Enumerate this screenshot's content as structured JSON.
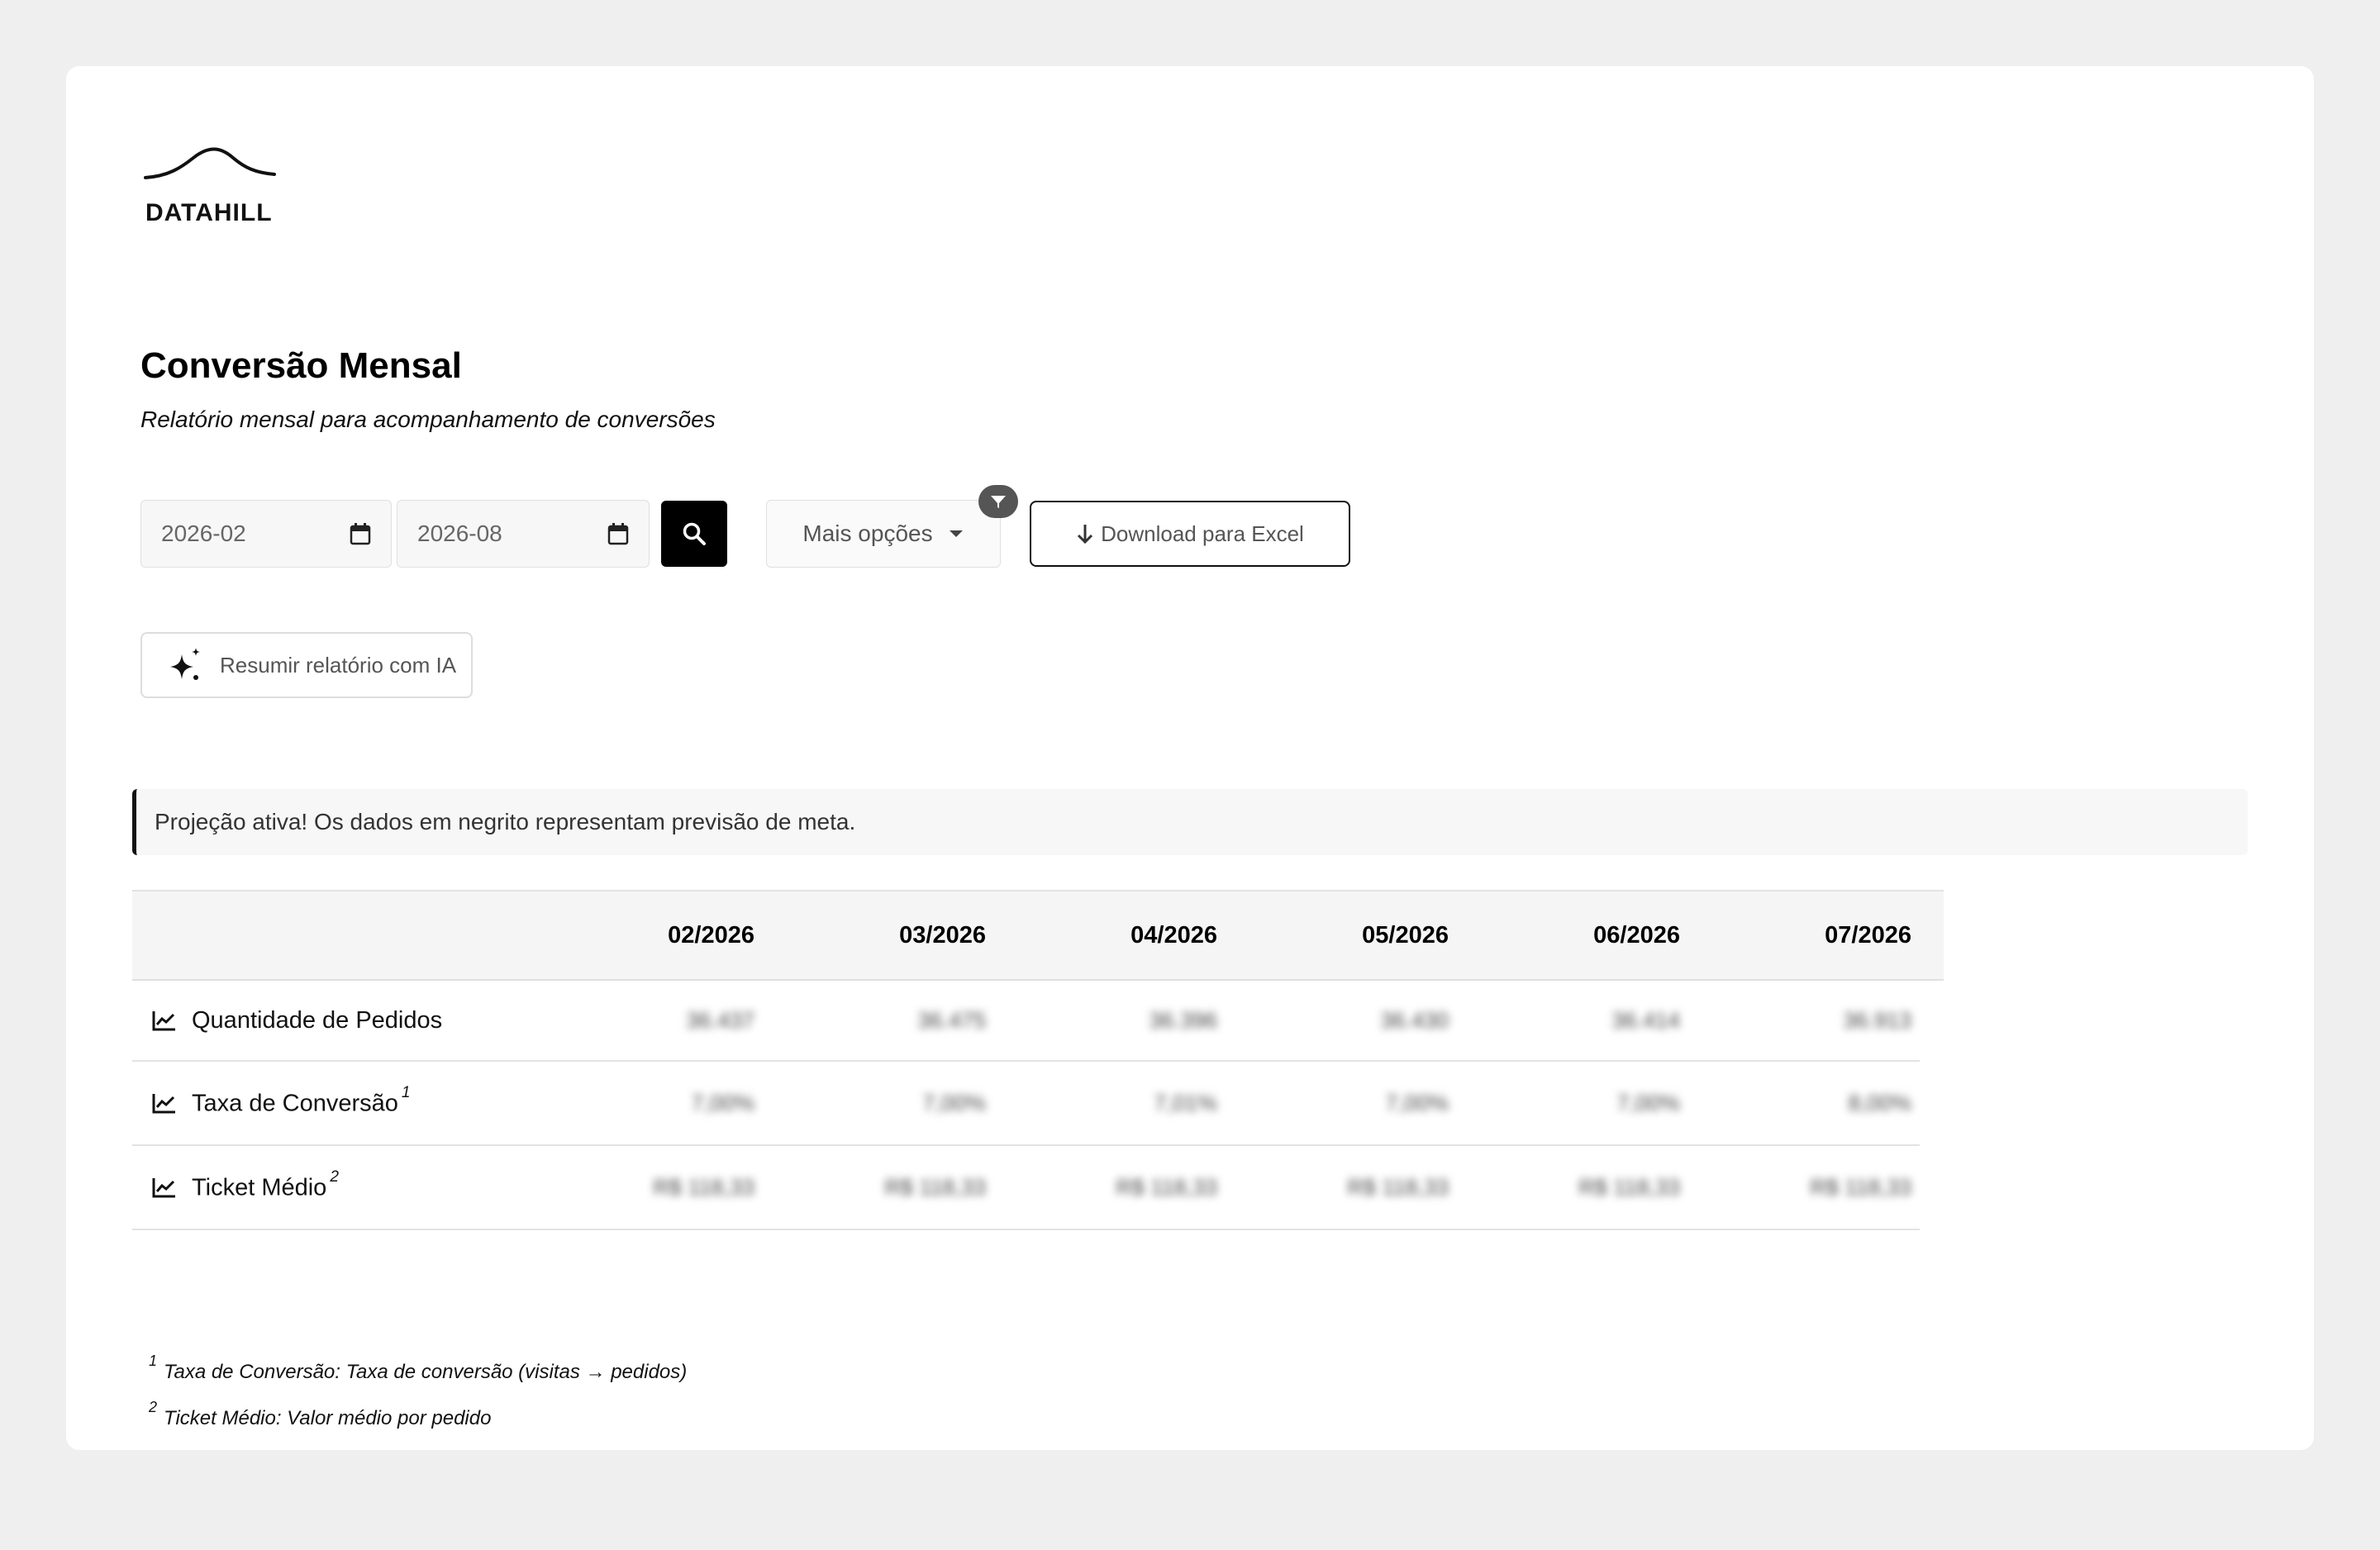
{
  "logo": {
    "text": "DATAHILL",
    "icon": "hill-logo"
  },
  "page": {
    "title": "Conversão Mensal",
    "subtitle": "Relatório mensal para acompanhamento de conversões"
  },
  "filters": {
    "start_month": "2026-02",
    "end_month": "2026-08",
    "search_icon": "search-icon",
    "more_options_label": "Mais opções",
    "download_label": "Download para Excel",
    "ai_summary_label": "Resumir relatório com IA"
  },
  "notice": "Projeção ativa! Os dados em negrito representam previsão de meta.",
  "table": {
    "columns": [
      "02/2026",
      "03/2026",
      "04/2026",
      "05/2026",
      "06/2026",
      "07/2026"
    ],
    "rows": [
      {
        "label": "Quantidade de Pedidos",
        "note": "",
        "values": [
          "36.437",
          "36.475",
          "36.396",
          "36.430",
          "36.414",
          "36.913"
        ]
      },
      {
        "label": "Taxa de Conversão",
        "note": "1",
        "values": [
          "7,00%",
          "7,00%",
          "7,01%",
          "7,00%",
          "7,00%",
          "8,00%"
        ]
      },
      {
        "label": "Ticket Médio",
        "note": "2",
        "values": [
          "R$ 118,33",
          "R$ 118,33",
          "R$ 118,33",
          "R$ 118,33",
          "R$ 118,33",
          "R$ 118,33"
        ]
      }
    ]
  },
  "footnotes": [
    {
      "num": "1",
      "text": "Taxa de Conversão: Taxa de conversão (visitas → pedidos)"
    },
    {
      "num": "2",
      "text": "Ticket Médio: Valor médio por pedido"
    }
  ]
}
